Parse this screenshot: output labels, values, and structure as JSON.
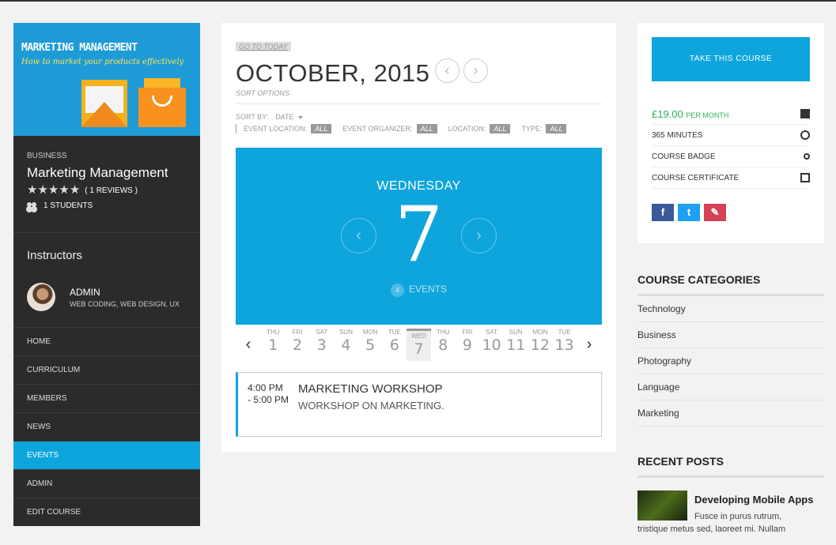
{
  "course": {
    "banner_title": "MARKETING MANAGEMENT",
    "banner_subtitle": "How to market your products effectively",
    "category": "BUSINESS",
    "title": "Marketing Management",
    "reviews": "( 1 REVIEWS )",
    "rating_stars": 5,
    "students": "1 STUDENTS"
  },
  "instructors": {
    "heading": "Instructors",
    "name": "ADMIN",
    "skills": "WEB CODING, WEB DESIGN, UX"
  },
  "nav": {
    "items": [
      "HOME",
      "CURRICULUM",
      "MEMBERS",
      "NEWS",
      "EVENTS",
      "ADMIN",
      "EDIT COURSE"
    ],
    "active": "EVENTS"
  },
  "calendar": {
    "goto_today": "GO TO TODAY",
    "month_title": "OCTOBER, 2015",
    "sort_options": "SORT OPTIONS",
    "sort_by_label": "SORT BY:",
    "sort_by_value": "DATE",
    "filters": [
      {
        "label": "EVENT LOCATION:",
        "value": "ALL"
      },
      {
        "label": "EVENT ORGANIZER:",
        "value": "ALL"
      },
      {
        "label": "LOCATION:",
        "value": "ALL"
      },
      {
        "label": "TYPE:",
        "value": "ALL"
      }
    ],
    "day_name": "WEDNESDAY",
    "day_number": "7",
    "events_count": "4",
    "events_label": "EVENTS",
    "days": [
      {
        "w": "THU",
        "n": "1"
      },
      {
        "w": "FRI",
        "n": "2"
      },
      {
        "w": "SAT",
        "n": "3"
      },
      {
        "w": "SUN",
        "n": "4"
      },
      {
        "w": "MON",
        "n": "5"
      },
      {
        "w": "TUE",
        "n": "6"
      },
      {
        "w": "WED",
        "n": "7"
      },
      {
        "w": "THU",
        "n": "8"
      },
      {
        "w": "FRI",
        "n": "9"
      },
      {
        "w": "SAT",
        "n": "10"
      },
      {
        "w": "SUN",
        "n": "11"
      },
      {
        "w": "MON",
        "n": "12"
      },
      {
        "w": "TUE",
        "n": "13"
      }
    ],
    "selected_day": "7",
    "event": {
      "time_start": "4:00 PM",
      "time_end": "- 5:00 PM",
      "title": "MARKETING WORKSHOP",
      "description": "WORKSHOP ON MARKETING."
    }
  },
  "course_box": {
    "take_label": "TAKE THIS COURSE",
    "price": "£19.00",
    "per_month": "PER MONTH",
    "duration": "365 MINUTES",
    "badge": "COURSE BADGE",
    "certificate": "COURSE CERTIFICATE",
    "social": {
      "facebook": "f",
      "twitter": "t",
      "pinterest": "✎"
    }
  },
  "categories": {
    "heading": "COURSE CATEGORIES",
    "items": [
      "Technology",
      "Business",
      "Photography",
      "Language",
      "Marketing"
    ]
  },
  "recent_posts": {
    "heading": "RECENT POSTS",
    "post_title": "Developing Mobile Apps",
    "excerpt_line1": "Fusce in purus rutrum,",
    "excerpt_line2": "tristique metus sed, laoreet mi. Nullam"
  },
  "colors": {
    "accent": "#0ea5dd",
    "sidebar": "#2b2b2b",
    "price": "#2eaf5e"
  }
}
